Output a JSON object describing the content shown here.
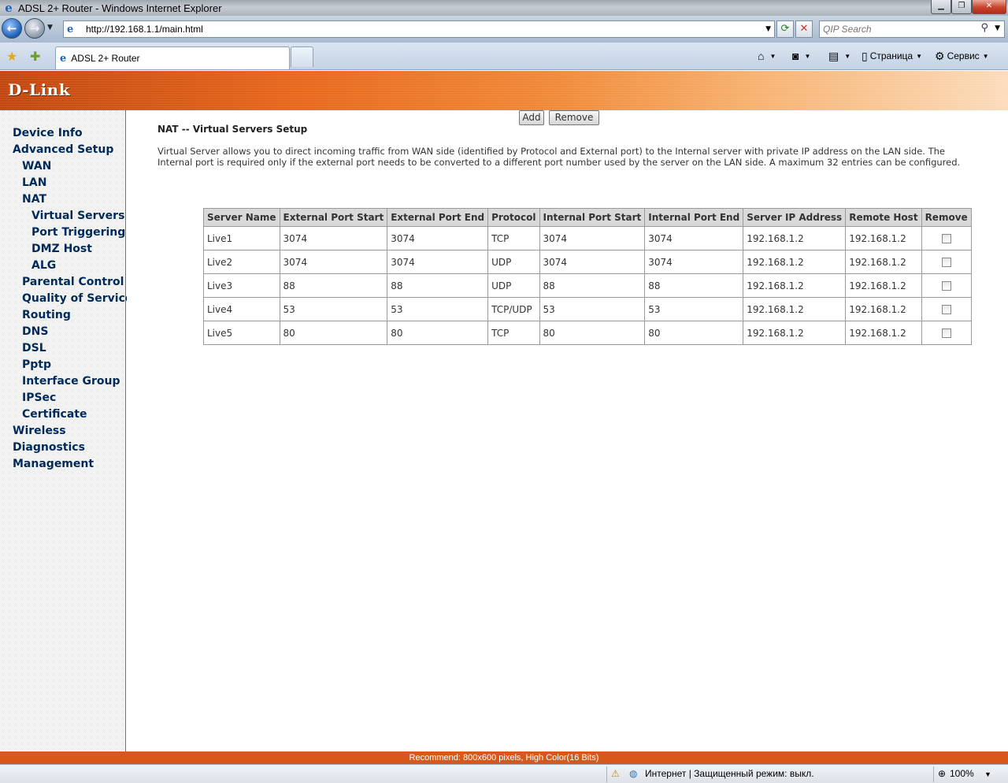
{
  "window": {
    "title": "ADSL 2+ Router - Windows Internet Explorer"
  },
  "browser": {
    "url": "http://192.168.1.1/main.html",
    "search_placeholder": "QIP Search",
    "tab_title": "ADSL 2+ Router",
    "cmd_page": "Страница",
    "cmd_tools": "Сервис"
  },
  "brand": {
    "logo": "D-Link",
    "accent_color": "#d6591c"
  },
  "menu": {
    "items": [
      {
        "label": "Device Info",
        "level": 0
      },
      {
        "label": "Advanced Setup",
        "level": 0
      },
      {
        "label": "WAN",
        "level": 1
      },
      {
        "label": "LAN",
        "level": 1
      },
      {
        "label": "NAT",
        "level": 1
      },
      {
        "label": "Virtual Servers",
        "level": 2
      },
      {
        "label": "Port Triggering",
        "level": 2
      },
      {
        "label": "DMZ Host",
        "level": 2
      },
      {
        "label": "ALG",
        "level": 2
      },
      {
        "label": "Parental Control",
        "level": 1
      },
      {
        "label": "Quality of Service",
        "level": 1
      },
      {
        "label": "Routing",
        "level": 1
      },
      {
        "label": "DNS",
        "level": 1
      },
      {
        "label": "DSL",
        "level": 1
      },
      {
        "label": "Pptp",
        "level": 1
      },
      {
        "label": "Interface Group",
        "level": 1
      },
      {
        "label": "IPSec",
        "level": 1
      },
      {
        "label": "Certificate",
        "level": 1
      },
      {
        "label": "Wireless",
        "level": 0
      },
      {
        "label": "Diagnostics",
        "level": 0
      },
      {
        "label": "Management",
        "level": 0
      }
    ]
  },
  "main": {
    "title": "NAT -- Virtual Servers Setup",
    "description": "Virtual Server allows you to direct incoming traffic from WAN side (identified by Protocol and External port) to the Internal server with private IP address on the LAN side. The Internal port is required only if the external port needs to be converted to a different port number used by the server on the LAN side. A maximum 32 entries can be configured.",
    "add_label": "Add",
    "remove_label": "Remove",
    "columns": [
      "Server Name",
      "External Port Start",
      "External Port End",
      "Protocol",
      "Internal Port Start",
      "Internal Port End",
      "Server IP Address",
      "Remote Host",
      "Remove"
    ],
    "rows": [
      [
        "Live1",
        "3074",
        "3074",
        "TCP",
        "3074",
        "3074",
        "192.168.1.2",
        "192.168.1.2"
      ],
      [
        "Live2",
        "3074",
        "3074",
        "UDP",
        "3074",
        "3074",
        "192.168.1.2",
        "192.168.1.2"
      ],
      [
        "Live3",
        "88",
        "88",
        "UDP",
        "88",
        "88",
        "192.168.1.2",
        "192.168.1.2"
      ],
      [
        "Live4",
        "53",
        "53",
        "TCP/UDP",
        "53",
        "53",
        "192.168.1.2",
        "192.168.1.2"
      ],
      [
        "Live5",
        "80",
        "80",
        "TCP",
        "80",
        "80",
        "192.168.1.2",
        "192.168.1.2"
      ]
    ]
  },
  "footer": {
    "text": "Recommend: 800x600 pixels, High Color(16 Bits)"
  },
  "status": {
    "zone": "Интернет | Защищенный режим: выкл.",
    "zoom": "100%"
  }
}
